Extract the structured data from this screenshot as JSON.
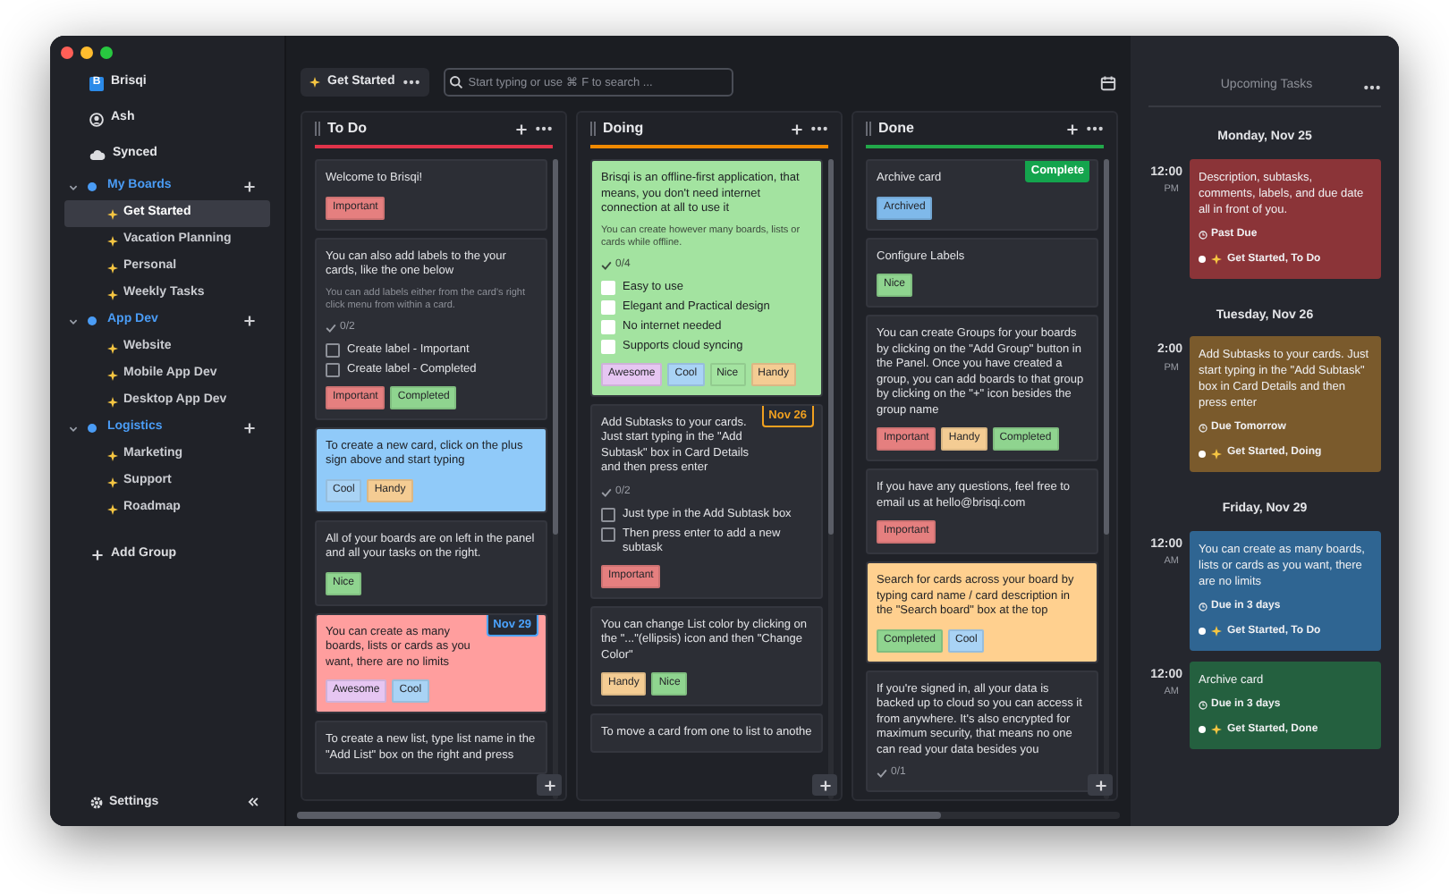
{
  "sidebar": {
    "app": {
      "logo_letter": "B",
      "name": "Brisqi"
    },
    "user": "Ash",
    "sync_status": "Synced",
    "groups": [
      {
        "name": "My Boards",
        "expanded": true,
        "boards": [
          {
            "name": "Get Started",
            "selected": true
          },
          {
            "name": "Vacation Planning",
            "selected": false
          },
          {
            "name": "Personal",
            "selected": false
          },
          {
            "name": "Weekly Tasks",
            "selected": false
          }
        ]
      },
      {
        "name": "App Dev",
        "expanded": true,
        "boards": [
          {
            "name": "Website",
            "selected": false
          },
          {
            "name": "Mobile App Dev",
            "selected": false
          },
          {
            "name": "Desktop App Dev",
            "selected": false
          }
        ]
      },
      {
        "name": "Logistics",
        "expanded": true,
        "boards": [
          {
            "name": "Marketing",
            "selected": false
          },
          {
            "name": "Support",
            "selected": false
          },
          {
            "name": "Roadmap",
            "selected": false
          }
        ]
      }
    ],
    "add_group": "Add Group",
    "settings": "Settings"
  },
  "toolbar": {
    "board": "Get Started",
    "search": {
      "placeholder": "Start typing or use ⌘ F to search ..."
    }
  },
  "lists": [
    {
      "title": "To Do",
      "color": "#e0334a",
      "cards": [
        {
          "color": "#2c2e35",
          "text": "Welcome to Brisqi!",
          "labels": [
            {
              "text": "Important",
              "color": "#e57f7f"
            }
          ]
        },
        {
          "color": "#2c2e35",
          "text": "You can also add labels to the your cards, like the one below",
          "note": "You can add labels either from the card's right click menu from within a card.",
          "progress": "0/2",
          "subtasks": [
            {
              "text": "Create label - Important",
              "checked": false
            },
            {
              "text": "Create label - Completed",
              "checked": false
            }
          ],
          "labels": [
            {
              "text": "Important",
              "color": "#e57f7f"
            },
            {
              "text": "Completed",
              "color": "#8fd48f"
            }
          ]
        },
        {
          "color": "#90caf9",
          "text": "To create a new card, click on the plus sign above and start typing",
          "labels": [
            {
              "text": "Cool",
              "color": "#a9d3f5"
            },
            {
              "text": "Handy",
              "color": "#f4cc93"
            }
          ]
        },
        {
          "color": "#2c2e35",
          "text": "All of your boards are on left in the panel and all your tasks on the right.",
          "labels": [
            {
              "text": "Nice",
              "color": "#8fd48f"
            }
          ]
        },
        {
          "color": "#ff9e9e",
          "text": "You can create as many boards, lists or cards as you want, there are no limits",
          "badge": {
            "kind": "date",
            "text": "Nov 29",
            "color": "#4ba3ff"
          },
          "labels": [
            {
              "text": "Awesome",
              "color": "#e6c6f2"
            },
            {
              "text": "Cool",
              "color": "#a9d3f5"
            }
          ]
        },
        {
          "color": "#2c2e35",
          "text": "To create a new list, type list name in the \"Add List\" box on the right and press"
        }
      ]
    },
    {
      "title": "Doing",
      "color": "#f08a00",
      "cards": [
        {
          "color": "#a3e3a0",
          "text": "Brisqi is an offline-first application, that means, you don't need internet connection at all to use it",
          "note": "You can create however many boards, lists or cards while offline.",
          "progress": "0/4",
          "subtasks": [
            {
              "text": "Easy to use",
              "checked": false
            },
            {
              "text": "Elegant and Practical design",
              "checked": false
            },
            {
              "text": "No internet needed",
              "checked": false
            },
            {
              "text": "Supports cloud syncing",
              "checked": false
            }
          ],
          "labels": [
            {
              "text": "Awesome",
              "color": "#e6c6f2"
            },
            {
              "text": "Cool",
              "color": "#a9d3f5"
            },
            {
              "text": "Nice",
              "color": "#a3e3a0"
            },
            {
              "text": "Handy",
              "color": "#f4cc93"
            }
          ]
        },
        {
          "color": "#2c2e35",
          "text": "Add Subtasks to your cards. Just start typing in the \"Add Subtask\" box in Card Details and then press enter",
          "badge": {
            "kind": "date",
            "text": "Nov 26",
            "color": "#f0a020"
          },
          "progress": "0/2",
          "subtasks": [
            {
              "text": "Just type in the Add Subtask box",
              "checked": false
            },
            {
              "text": "Then press enter to add a new subtask",
              "checked": false
            }
          ],
          "labels": [
            {
              "text": "Important",
              "color": "#e57f7f"
            }
          ]
        },
        {
          "color": "#2c2e35",
          "text": "You can change List color by clicking on the \"...\"(ellipsis) icon and then \"Change Color\"",
          "labels": [
            {
              "text": "Handy",
              "color": "#f4cc93"
            },
            {
              "text": "Nice",
              "color": "#8fd48f"
            }
          ]
        },
        {
          "color": "#2c2e35",
          "text": "To move a card from one to list to anothe"
        }
      ]
    },
    {
      "title": "Done",
      "color": "#22a84a",
      "cards": [
        {
          "color": "#2c2e35",
          "text": "Archive card",
          "badge": {
            "kind": "status",
            "text": "Complete",
            "color": "#14a44d"
          },
          "labels": [
            {
              "text": "Archived",
              "color": "#7fb9ea"
            }
          ]
        },
        {
          "color": "#2c2e35",
          "text": "Configure Labels",
          "labels": [
            {
              "text": "Nice",
              "color": "#8fd48f"
            }
          ]
        },
        {
          "color": "#2c2e35",
          "text": "You can create Groups for your boards by clicking on the \"Add Group\" button in the Panel. Once you have created a group, you can add boards to that group by clicking on the \"+\" icon besides the group name",
          "labels": [
            {
              "text": "Important",
              "color": "#e57f7f"
            },
            {
              "text": "Handy",
              "color": "#f4cc93"
            },
            {
              "text": "Completed",
              "color": "#8fd48f"
            }
          ]
        },
        {
          "color": "#2c2e35",
          "text": "If you have any questions, feel free to email us at hello@brisqi.com",
          "labels": [
            {
              "text": "Important",
              "color": "#e57f7f"
            }
          ]
        },
        {
          "color": "#ffd08f",
          "text": "Search for cards across your board by typing card name / card description in the \"Search board\" box at the top",
          "labels": [
            {
              "text": "Completed",
              "color": "#8fd48f"
            },
            {
              "text": "Cool",
              "color": "#a9d3f5"
            }
          ]
        },
        {
          "color": "#2c2e35",
          "text": "If you're signed in, all your data is backed up to cloud so you can access it from anywhere. It's also encrypted for maximum security, that means no one can read your data besides you",
          "progress": "0/1"
        }
      ]
    }
  ],
  "upcoming": {
    "title": "Upcoming Tasks",
    "days": [
      {
        "date": "Monday, Nov 25",
        "tasks": [
          {
            "time": "12:00",
            "meridiem": "PM",
            "color": "#8b3438",
            "text": "Description, subtasks, comments, labels, and due date all in front of you.",
            "status": "Past Due",
            "board": "Get Started, To Do"
          }
        ]
      },
      {
        "date": "Tuesday, Nov 26",
        "tasks": [
          {
            "time": "2:00",
            "meridiem": "PM",
            "color": "#7a5a2c",
            "text": "Add Subtasks to your cards. Just start typing in the \"Add Subtask\" box in Card Details and then press enter",
            "status": "Due Tomorrow",
            "board": "Get Started, Doing"
          }
        ]
      },
      {
        "date": "Friday, Nov 29",
        "tasks": [
          {
            "time": "12:00",
            "meridiem": "AM",
            "color": "#2f6592",
            "text": "You can create as many boards, lists or cards as you want, there are no limits",
            "status": "Due in 3 days",
            "board": "Get Started, To Do"
          },
          {
            "time": "12:00",
            "meridiem": "AM",
            "color": "#24603f",
            "text": "Archive card",
            "status": "Due in 3 days",
            "board": "Get Started, Done"
          }
        ]
      }
    ]
  }
}
